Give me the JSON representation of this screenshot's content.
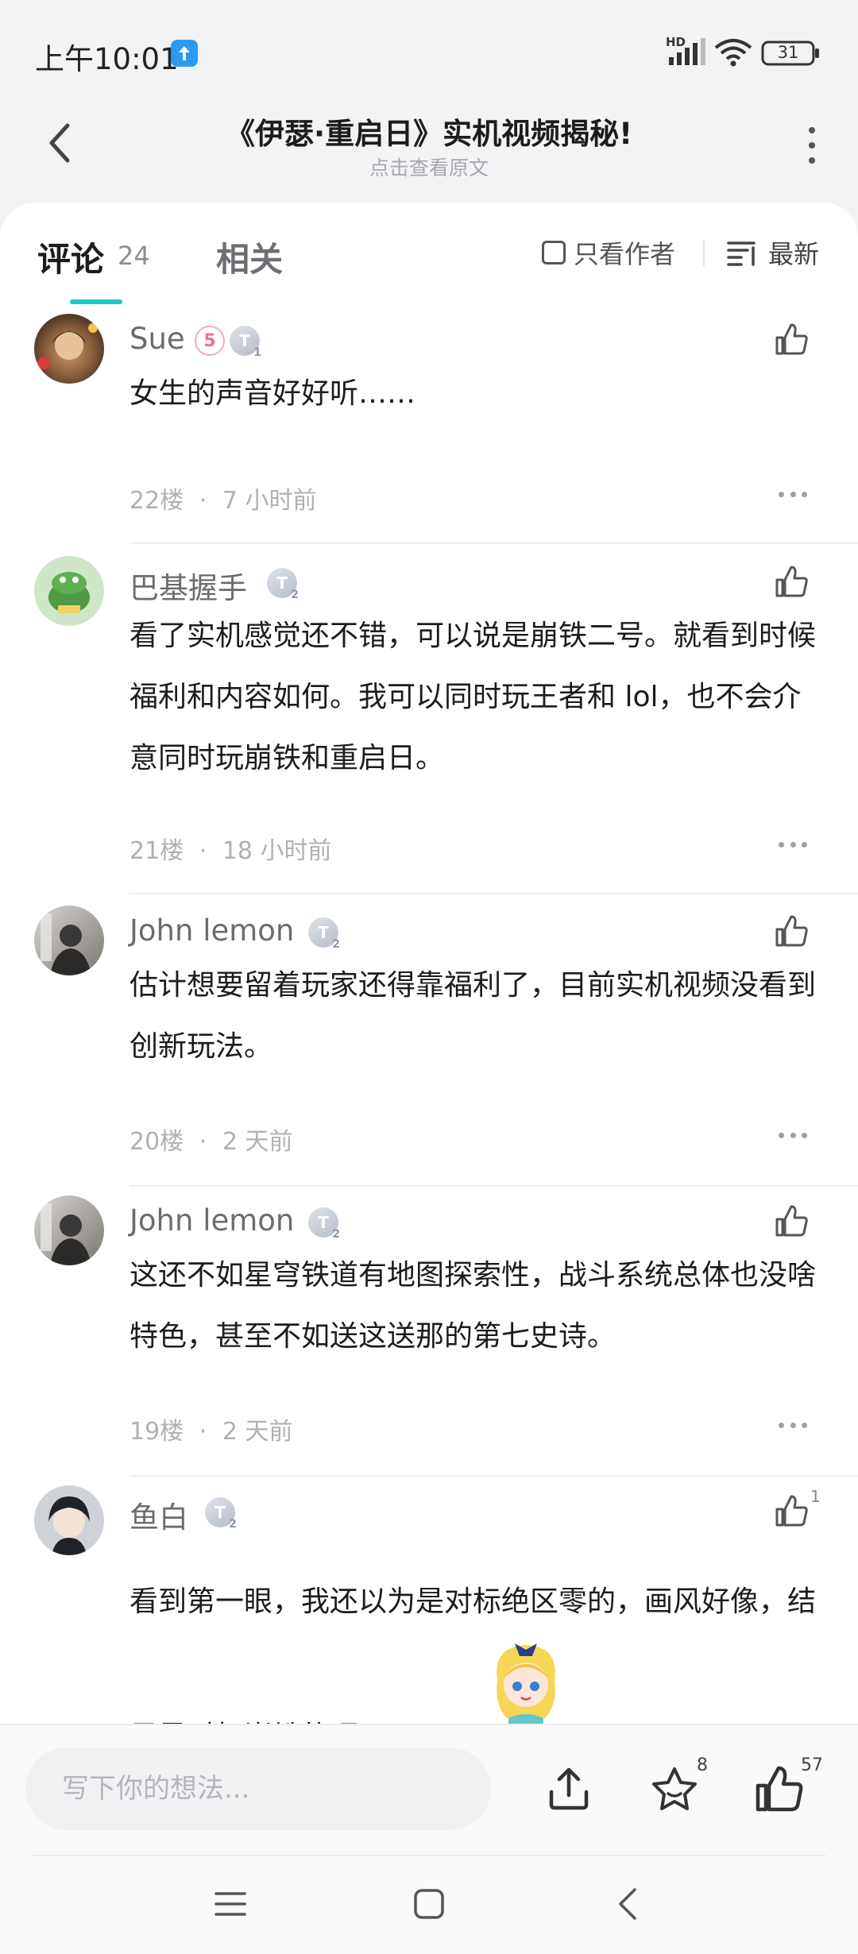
{
  "status_bar": {
    "time": "上午10:01",
    "network_label": "HD",
    "battery": "31"
  },
  "header": {
    "title": "《伊瑟·重启日》实机视频揭秘!",
    "subtitle": "点击查看原文"
  },
  "tabs": {
    "comments_label": "评论",
    "comments_count": "24",
    "related_label": "相关",
    "author_only_label": "只看作者",
    "sort_label": "最新"
  },
  "comments": [
    {
      "name": "Sue",
      "level_badge": "5",
      "tier_badge": "T",
      "tier_sub": "1",
      "text": "女生的声音好好听……",
      "floor": "22楼",
      "time": "7 小时前"
    },
    {
      "name": "巴基握手",
      "tier_badge": "T",
      "tier_sub": "2",
      "text": "看了实机感觉还不错，可以说是崩铁二号。就看到时候福利和内容如何。我可以同时玩王者和 lol，也不会介意同时玩崩铁和重启日。",
      "floor": "21楼",
      "time": "18 小时前"
    },
    {
      "name": "John lemon",
      "tier_badge": "T",
      "tier_sub": "2",
      "text": "估计想要留着玩家还得靠福利了，目前实机视频没看到创新玩法。",
      "floor": "20楼",
      "time": "2 天前"
    },
    {
      "name": "John lemon",
      "tier_badge": "T",
      "tier_sub": "2",
      "text": "这还不如星穹铁道有地图探索性，战斗系统总体也没啥特色，甚至不如送这送那的第七史诗。",
      "floor": "19楼",
      "time": "2 天前"
    },
    {
      "name": "鱼白",
      "tier_badge": "T",
      "tier_sub": "2",
      "like_count": "1",
      "text": "看到第一眼，我还以为是对标绝区零的，画风好像，结果是对标崩铁的呀",
      "floor": "",
      "time": ""
    }
  ],
  "meta_separator": "·",
  "bottom_bar": {
    "input_placeholder": "写下你的想法...",
    "favorite_count": "8",
    "like_count": "57"
  },
  "colors": {
    "accent": "#1ec8c8",
    "background": "#f2f3f5",
    "text_primary": "#1c1c1e",
    "text_secondary": "#6c6c70"
  }
}
